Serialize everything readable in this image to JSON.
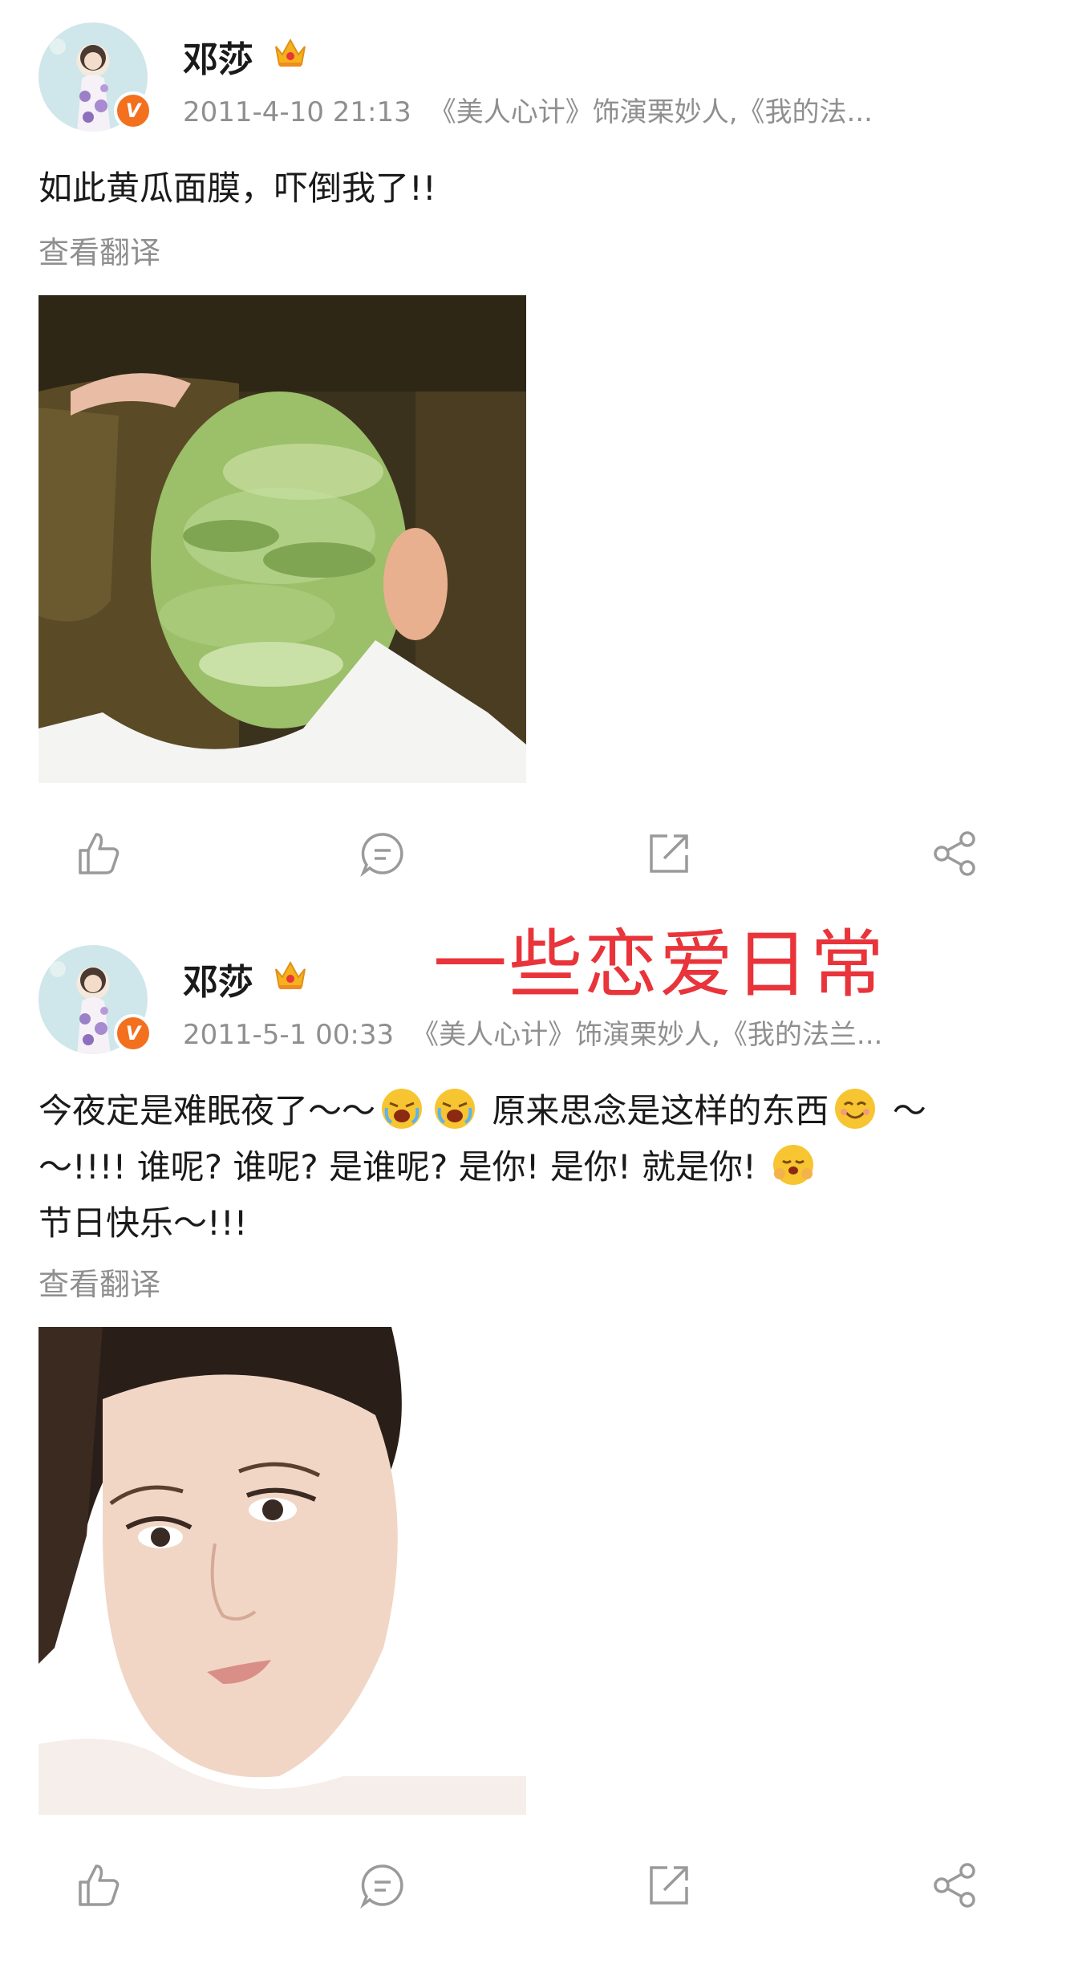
{
  "posts": [
    {
      "user": {
        "name": "邓莎",
        "verified_badge": "V"
      },
      "timestamp": "2011-4-10 21:13",
      "source": "《美人心计》饰演栗妙人,《我的法...",
      "text": "如此黄瓜面膜，吓倒我了!!",
      "translate_label": "查看翻译",
      "image": "cucumber-face-mask-photo",
      "actions": [
        "like-icon",
        "comment-icon",
        "repost-icon",
        "share-icon"
      ]
    },
    {
      "user": {
        "name": "邓莎",
        "verified_badge": "V"
      },
      "timestamp": "2011-5-1 00:33",
      "source": "《美人心计》饰演栗妙人,《我的法兰...",
      "text_line1_a": "今夜定是难眠夜了～～",
      "text_line1_b": "原来思念是这样的东西",
      "text_line1_c": "～",
      "text_line2_a": "～!!!! 谁呢? 谁呢? 是谁呢? 是你! 是你! 就是你!",
      "text_line3": "节日快乐～!!!",
      "translate_label": "查看翻译",
      "image": "portrait-photo",
      "actions": [
        "like-icon",
        "comment-icon",
        "repost-icon",
        "share-icon"
      ]
    }
  ],
  "overlay_caption": "一些恋爱日常",
  "colors": {
    "accent_red": "#e8343a",
    "badge_orange": "#f2701e",
    "meta_gray": "#8f8f8f",
    "icon_gray": "#9a9a9a"
  }
}
